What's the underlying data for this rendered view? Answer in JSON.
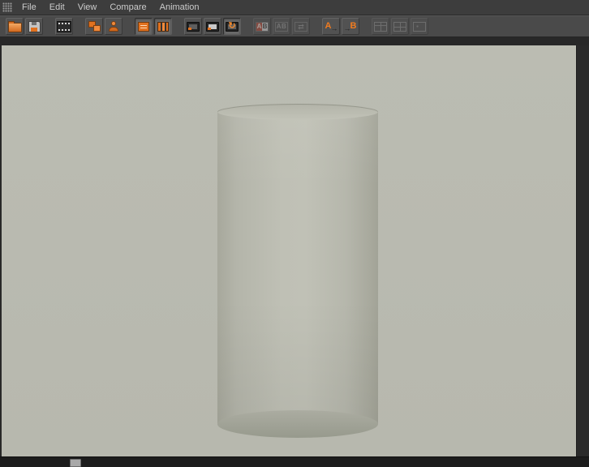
{
  "menu": {
    "items": [
      {
        "label": "File"
      },
      {
        "label": "Edit"
      },
      {
        "label": "View"
      },
      {
        "label": "Compare"
      },
      {
        "label": "Animation"
      }
    ]
  },
  "toolbar": {
    "buttons": [
      {
        "id": "open",
        "icon": "folder-open-icon",
        "state": "normal"
      },
      {
        "id": "save",
        "icon": "save-icon",
        "state": "normal"
      },
      {
        "id": "movie",
        "icon": "filmstrip-icon",
        "state": "normal"
      },
      {
        "id": "copy-frames",
        "icon": "stacked-frames-icon",
        "state": "normal"
      },
      {
        "id": "object-preview",
        "icon": "person-icon",
        "state": "normal"
      },
      {
        "id": "layers",
        "icon": "layers-icon",
        "state": "pressed"
      },
      {
        "id": "stack",
        "icon": "stack-icon",
        "state": "pressed"
      },
      {
        "id": "monitor-a",
        "icon": "monitor-icon",
        "state": "normal"
      },
      {
        "id": "monitor-b",
        "icon": "monitor-screen-icon",
        "state": "normal"
      },
      {
        "id": "monitor-refresh",
        "icon": "monitor-refresh-icon",
        "glyph": "↻",
        "state": "pressed"
      },
      {
        "id": "compare-ab",
        "icon": "ab-compare-icon",
        "letter_a": "A",
        "letter_b": "B",
        "state": "disabled"
      },
      {
        "id": "compare-ab-alt",
        "icon": "ab-gray-icon",
        "letters": "AB",
        "state": "disabled"
      },
      {
        "id": "compare-swap",
        "icon": "ab-swap-icon",
        "glyph": "⇄",
        "state": "disabled"
      },
      {
        "id": "set-image-a",
        "icon": "set-a-icon",
        "letter": "A",
        "arrow": "→",
        "state": "normal"
      },
      {
        "id": "set-image-b",
        "icon": "set-b-icon",
        "letter": "B",
        "arrow": "→",
        "state": "normal"
      },
      {
        "id": "layout-grid-columns",
        "icon": "grid-columns-icon",
        "state": "disabled"
      },
      {
        "id": "layout-grid-cells",
        "icon": "grid-cells-icon",
        "state": "disabled"
      },
      {
        "id": "layout-grid-thumbs",
        "icon": "grid-thumbs-icon",
        "state": "disabled"
      }
    ]
  },
  "viewport": {
    "content": "gray cylinder render",
    "background": "#b9bab0"
  },
  "colors": {
    "menubar_bg": "#3d3d3d",
    "toolbar_bg": "#4a4a4a",
    "window_bg": "#282828",
    "viewport_bg": "#b9bab0",
    "cylinder_mid": "#bfc0b5",
    "cylinder_edge": "#a7a89c",
    "cylinder_bottom": "#999a8f",
    "accent_orange": "#e0711f",
    "menu_text": "#cccccc"
  }
}
